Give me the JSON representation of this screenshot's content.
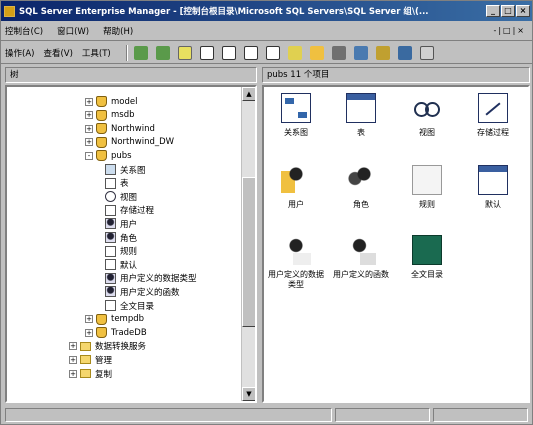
{
  "window": {
    "title": "SQL Server Enterprise Manager - [控制台根目录\\Microsoft SQL Servers\\SQL Server 组\\(..."
  },
  "menubar": {
    "items": [
      "控制台(C)",
      "窗口(W)",
      "帮助(H)"
    ],
    "mdi_controls": "-|□|×"
  },
  "toolbar": {
    "items": [
      "操作(A)",
      "查看(V)",
      "工具(T)"
    ]
  },
  "left_pane": {
    "header": "树",
    "tree": [
      {
        "label": "model",
        "type": "db",
        "expander": "+"
      },
      {
        "label": "msdb",
        "type": "db",
        "expander": "+"
      },
      {
        "label": "Northwind",
        "type": "db",
        "expander": "+"
      },
      {
        "label": "Northwind_DW",
        "type": "db",
        "expander": "+"
      },
      {
        "label": "pubs",
        "type": "db",
        "expander": "-"
      },
      {
        "label": "关系图",
        "type": "diagram"
      },
      {
        "label": "表",
        "type": "page"
      },
      {
        "label": "视图",
        "type": "glasses"
      },
      {
        "label": "存储过程",
        "type": "page"
      },
      {
        "label": "用户",
        "type": "person"
      },
      {
        "label": "角色",
        "type": "person"
      },
      {
        "label": "规则",
        "type": "page"
      },
      {
        "label": "默认",
        "type": "page"
      },
      {
        "label": "用户定义的数据类型",
        "type": "person"
      },
      {
        "label": "用户定义的函数",
        "type": "person"
      },
      {
        "label": "全文目录",
        "type": "page"
      },
      {
        "label": "tempdb",
        "type": "db",
        "expander": "+"
      },
      {
        "label": "TradeDB",
        "type": "db",
        "expander": "+"
      },
      {
        "label": "数据转换服务",
        "type": "folder",
        "expander": "+"
      },
      {
        "label": "管理",
        "type": "folder",
        "expander": "+"
      },
      {
        "label": "复制",
        "type": "folder",
        "expander": "+"
      }
    ]
  },
  "right_pane": {
    "header": "pubs   11 个项目",
    "items": [
      {
        "label": "关系图",
        "icon": "diagram-icon"
      },
      {
        "label": "表",
        "icon": "table-icon"
      },
      {
        "label": "视图",
        "icon": "view-icon"
      },
      {
        "label": "存储过程",
        "icon": "stored-procedure-icon"
      },
      {
        "label": "用户",
        "icon": "user-icon"
      },
      {
        "label": "角色",
        "icon": "role-icon"
      },
      {
        "label": "规则",
        "icon": "rule-icon"
      },
      {
        "label": "默认",
        "icon": "default-icon"
      },
      {
        "label": "用户定义的数据类型",
        "icon": "udt-icon"
      },
      {
        "label": "用户定义的函数",
        "icon": "udf-icon"
      },
      {
        "label": "全文目录",
        "icon": "fulltext-catalog-icon"
      }
    ]
  }
}
